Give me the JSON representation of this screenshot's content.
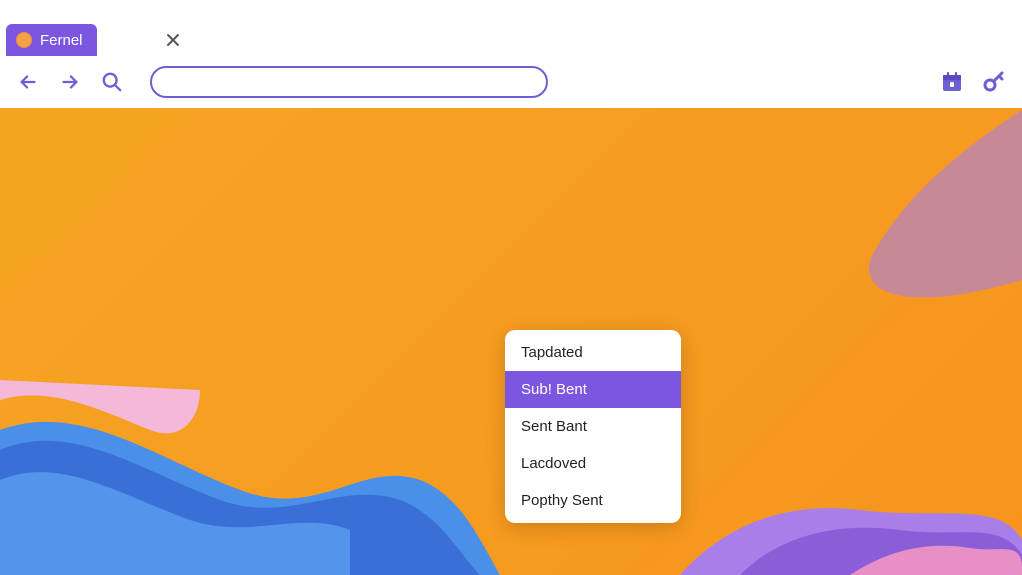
{
  "tab": {
    "title": "Fernel"
  },
  "toolbar": {
    "url_value": "",
    "url_placeholder": ""
  },
  "context_menu": {
    "items": [
      {
        "label": "Tapdated",
        "highlighted": false
      },
      {
        "label": "Sub! Bent",
        "highlighted": true
      },
      {
        "label": "Sent Bant",
        "highlighted": false
      },
      {
        "label": "Lacdoved",
        "highlighted": false
      },
      {
        "label": "Popthy Sent",
        "highlighted": false
      }
    ]
  },
  "colors": {
    "accent": "#7b57e0",
    "background_primary": "#f7941e"
  }
}
